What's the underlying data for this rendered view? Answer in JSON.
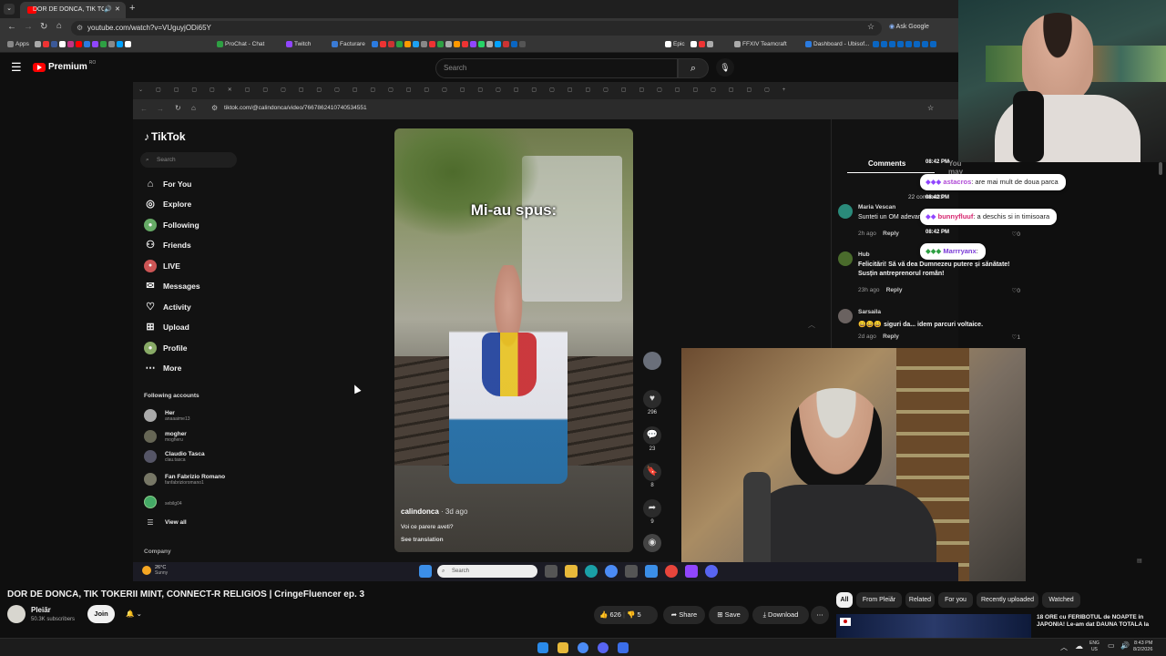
{
  "outer_browser": {
    "active_tab_title": "DOR DE DONCA, TIK TOKERII MINT",
    "url": "youtube.com/watch?v=VUguyjODi65Y",
    "ask_google": "Ask Google",
    "bookmarks": [
      "Apps",
      "ProChat - Chat",
      "Twitch",
      "Facturare",
      "Epic",
      "FFXIV Teamcraft",
      "Dashboard - Ubisof..."
    ]
  },
  "youtube_header": {
    "logo": "Premium",
    "logo_region": "RO",
    "search_placeholder": "Search"
  },
  "inner_browser": {
    "url": "tiktok.com/@calindonca/video/7667862410740534551"
  },
  "tiktok": {
    "logo": "TikTok",
    "search_placeholder": "Search",
    "nav": [
      {
        "icon": "home-icon",
        "label": "For You"
      },
      {
        "icon": "compass-icon",
        "label": "Explore"
      },
      {
        "icon": "following-icon",
        "label": "Following"
      },
      {
        "icon": "friends-icon",
        "label": "Friends"
      },
      {
        "icon": "live-icon",
        "label": "LIVE"
      },
      {
        "icon": "messages-icon",
        "label": "Messages"
      },
      {
        "icon": "activity-icon",
        "label": "Activity"
      },
      {
        "icon": "upload-icon",
        "label": "Upload"
      },
      {
        "icon": "profile-icon",
        "label": "Profile"
      },
      {
        "icon": "more-icon",
        "label": "More"
      }
    ],
    "following_title": "Following accounts",
    "following": [
      {
        "name": "Her",
        "handle": "anaaaime13"
      },
      {
        "name": "mogher",
        "handle": "mogheru"
      },
      {
        "name": "Claudio Tasca",
        "handle": "clau.tasca"
      },
      {
        "name": "Fan Fabrizio Romano",
        "handle": "fanfabrizioromano1"
      },
      {
        "name": "",
        "handle": "sebilg04"
      }
    ],
    "view_all": "View all",
    "company": "Company",
    "video": {
      "overlay_text": "Mi-au spus:",
      "author": "calindonca",
      "age": "· 3d ago",
      "caption": "Voi ce parere aveti?",
      "see_translation": "See translation"
    },
    "actions": {
      "likes": "296",
      "comments": "23",
      "saves": "8",
      "shares": "9"
    },
    "comments_tab": "Comments",
    "you_may_like_tab": "You may like",
    "comments_count": "22 comments",
    "comments": [
      {
        "name": "Maria Vescan",
        "text": "Sunteti un OM adevarat",
        "time": "2h ago",
        "reply": "Reply",
        "likes": "0"
      },
      {
        "name": "Hub",
        "text": "Felicitări! Să vă dea Dumnezeu putere și sănătate! Susțin antreprenorul român!",
        "time": "23h ago",
        "reply": "Reply",
        "likes": "0"
      },
      {
        "name": "Sarsaila",
        "text": "😄😄😄 siguri da... idem parcuri voltaice.",
        "time": "2d ago",
        "reply": "Reply",
        "likes": "1"
      }
    ]
  },
  "chat": [
    {
      "time": "08:42 PM",
      "user": "astacros",
      "message": ": are mai mult de doua parca"
    },
    {
      "time": "08:42 PM",
      "user": "bunnyfluuf",
      "message": ": a deschis si in timisoara"
    },
    {
      "time": "08:42 PM",
      "user": "Marrryanx",
      "message": ":"
    }
  ],
  "inner_taskbar": {
    "temp": "26°C",
    "weather": "Sunny",
    "search": "Search"
  },
  "youtube_info": {
    "title": "DOR DE DONCA, TIK TOKERII MINT, CONNECT-R RELIGIOS | CringeFluencer ep. 3",
    "channel": "Pleiăr",
    "subscribers": "50.3K subscribers",
    "join": "Join",
    "likes": "626",
    "dislikes": "5",
    "share": "Share",
    "save": "Save",
    "download": "Download",
    "chips": [
      "All",
      "From Pleiăr",
      "Related",
      "For you",
      "Recently uploaded",
      "Watched"
    ],
    "next_video_title": "18 ORE cu FERIBOTUL de NOAPTE in JAPONIA! Le-am dat DAUNA TOTALA la"
  },
  "windows_taskbar": {
    "lang": "ENG",
    "region": "US",
    "time": "8:43 PM",
    "date": "8/2/2026"
  }
}
